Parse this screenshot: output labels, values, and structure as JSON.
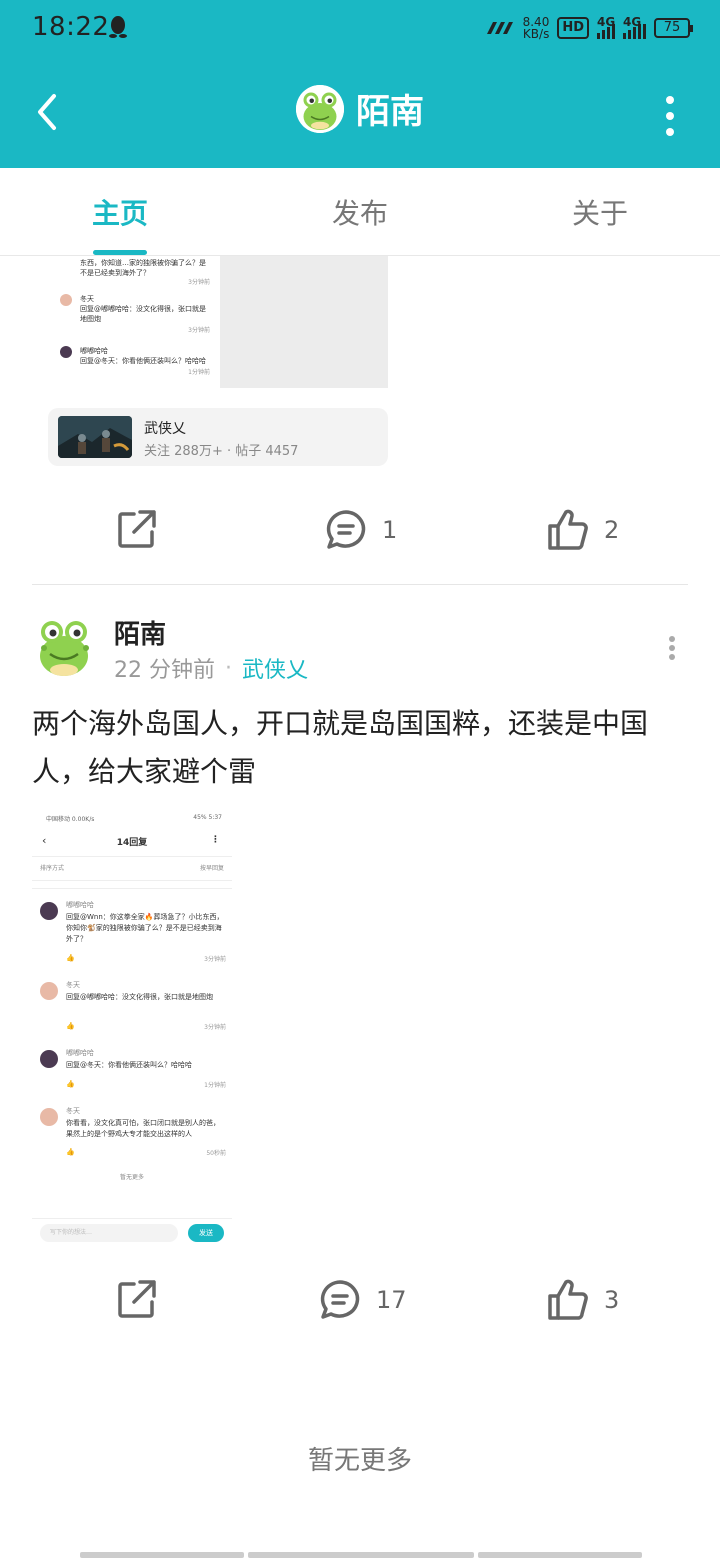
{
  "status_bar": {
    "time": "18:22",
    "network_speed": "8.40",
    "network_unit": "KB/s",
    "hd_label": "HD",
    "sim1_label": "4G",
    "sim2_label": "4G",
    "battery": "75"
  },
  "nav": {
    "title": "陌南"
  },
  "tabs": [
    {
      "label": "主页",
      "active": true
    },
    {
      "label": "发布",
      "active": false
    },
    {
      "label": "关于",
      "active": false
    }
  ],
  "post1": {
    "forum_card": {
      "name": "武侠乂",
      "stats": "关注 288万+ · 帖子 4457"
    },
    "actions": {
      "comments": "1",
      "likes": "2"
    },
    "shot_comments": [
      {
        "text": "东西，你知道…家的独限被你骗了么？是不是已经卖到海外了？",
        "time": "3分钟前"
      },
      {
        "name": "冬天",
        "text": "回复@嘟嘟哈哈：没文化得很，张口就是地图炮",
        "time": "3分钟前"
      },
      {
        "name": "嘟嘟哈哈",
        "text": "回复@冬天：你看他俩还装叫么？哈哈哈",
        "time": "1分钟前"
      }
    ]
  },
  "post2": {
    "author": "陌南",
    "time_ago": "22 分钟前",
    "forum": "武侠乂",
    "text": "两个海外岛国人，开口就是岛国国粹，还装是中国人，给大家避个雷",
    "screenshot": {
      "status_left": "中国移动 0.00K/s",
      "status_right": "45% 5:37",
      "title": "14回复",
      "sort_label": "排序方式",
      "sort_value": "按早回复",
      "comments": [
        {
          "name": "嘟嘟哈哈",
          "text": "回复@Wnn：你这拳全家🔥葬场急了？小比东西，你知你🐒家的独限被你骗了么？是不是已经卖到海外了？",
          "time": "3分钟前"
        },
        {
          "name": "冬天",
          "text": "回复@嘟嘟哈哈：没文化得很，张口就是地图炮",
          "time": "3分钟前"
        },
        {
          "name": "嘟嘟哈哈",
          "text": "回复@冬天：你看他俩还装叫么？哈哈哈",
          "time": "1分钟前"
        },
        {
          "name": "冬天",
          "text": "你看看，没文化真可怕，张口闭口就是别人的爸，果然上的是个野鸡大专才能交出这样的人",
          "time": "50秒前"
        }
      ],
      "end_text": "暂无更多",
      "input_placeholder": "写下你的想法…",
      "send_label": "发送"
    },
    "actions": {
      "comments": "17",
      "likes": "3"
    }
  },
  "footer": {
    "no_more": "暂无更多"
  }
}
